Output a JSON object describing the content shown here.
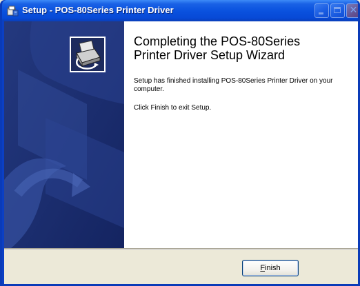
{
  "window": {
    "title": "Setup - POS-80Series Printer Driver",
    "icon": "setup-installer-icon",
    "controls": {
      "minimize": "minimize-icon",
      "maximize": "maximize-icon",
      "close": "close-icon"
    }
  },
  "side_panel": {
    "image": "printer-wizard-icon"
  },
  "main": {
    "heading": "Completing the POS-80Series\nPrinter Driver Setup Wizard",
    "message": "Setup has finished installing POS-80Series Printer Driver on your computer.",
    "instruction": "Click Finish to exit Setup."
  },
  "footer": {
    "finish_label_accel": "F",
    "finish_label_rest": "inish"
  },
  "colors": {
    "titlebar": "#0a52df",
    "side_panel": "#1b2e6e",
    "dialog_bg": "#ece9d8"
  }
}
